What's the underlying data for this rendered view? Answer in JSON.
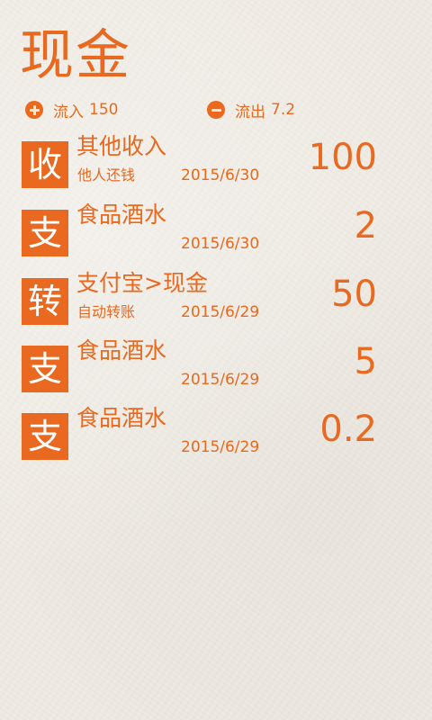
{
  "header": {
    "title": "现金"
  },
  "summary": {
    "inflow_label": "流入",
    "inflow_value": "150",
    "outflow_label": "流出",
    "outflow_value": "7.2"
  },
  "transactions": [
    {
      "type": "收",
      "category": "其他收入",
      "note": "他人还钱",
      "date": "2015/6/30",
      "amount": "100"
    },
    {
      "type": "支",
      "category": "食品酒水",
      "note": "",
      "date": "2015/6/30",
      "amount": "2"
    },
    {
      "type": "转",
      "category": "支付宝>现金",
      "note": "自动转账",
      "date": "2015/6/29",
      "amount": "50"
    },
    {
      "type": "支",
      "category": "食品酒水",
      "note": "",
      "date": "2015/6/29",
      "amount": "5"
    },
    {
      "type": "支",
      "category": "食品酒水",
      "note": "",
      "date": "2015/6/29",
      "amount": "0.2"
    }
  ],
  "colors": {
    "accent": "#e8691f",
    "background": "#efebe3"
  }
}
